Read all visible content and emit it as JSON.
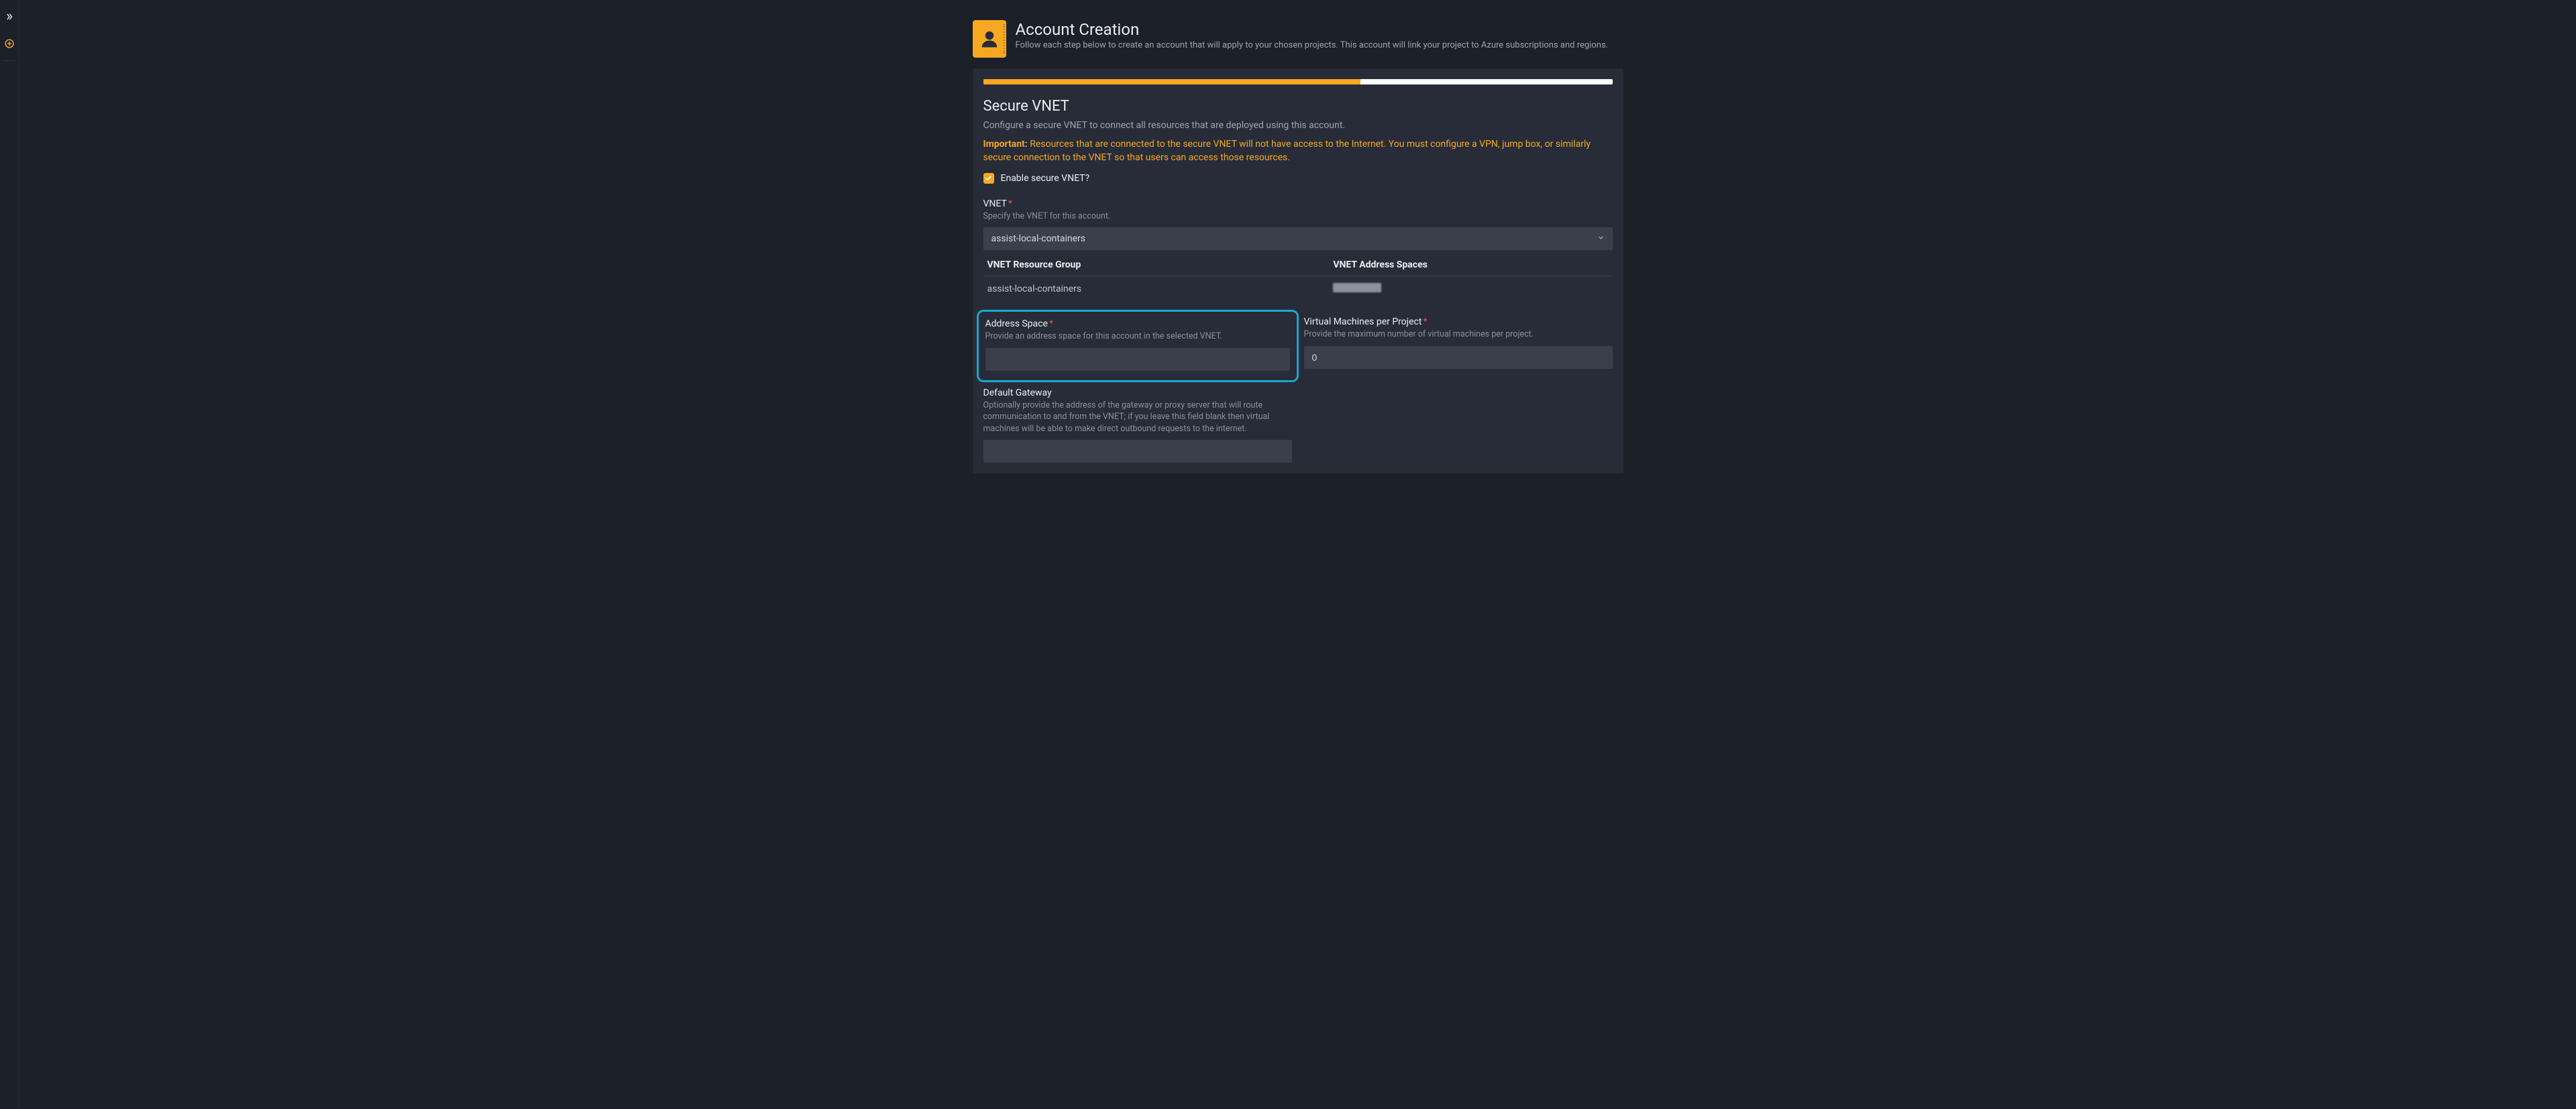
{
  "header": {
    "title": "Account Creation",
    "subtitle": "Follow each step below to create an account that will apply to your chosen projects. This account will link your project to Azure subscriptions and regions."
  },
  "progress": {
    "percent": 60
  },
  "section": {
    "title": "Secure VNET",
    "desc": "Configure a secure VNET to connect all resources that are deployed using this account.",
    "important_label": "Important:",
    "important_text": " Resources that are connected to the secure VNET will not have access to the Internet. You must configure a VPN, jump box, or similarly secure connection to the VNET so that users can access those resources.",
    "enable_label": "Enable secure VNET?"
  },
  "vnet_field": {
    "label": "VNET",
    "help": "Specify the VNET for this account.",
    "value": "assist-local-containers"
  },
  "vnet_table": {
    "headers": [
      "VNET Resource Group",
      "VNET Address Spaces"
    ],
    "rows": [
      {
        "group": "assist-local-containers",
        "spaces": ""
      }
    ]
  },
  "address_space": {
    "label": "Address Space",
    "help": "Provide an address space for this account in the selected VNET.",
    "value": ""
  },
  "vm_per_project": {
    "label": "Virtual Machines per Project",
    "help": "Provide the maximum number of virtual machines per project.",
    "value": "0"
  },
  "default_gateway": {
    "label": "Default Gateway",
    "help": "Optionally provide the address of the gateway or proxy server that will route communication to and from the VNET; if you leave this field blank then virtual machines will be able to make direct outbound requests to the internet.",
    "value": ""
  }
}
